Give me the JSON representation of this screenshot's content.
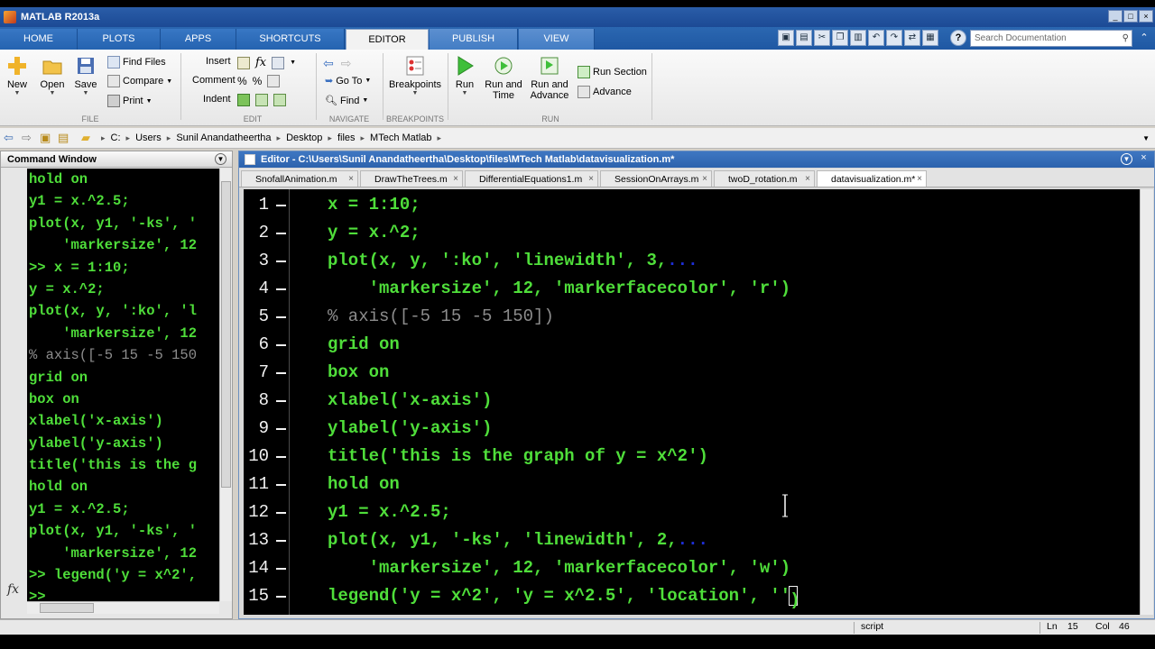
{
  "window": {
    "title": "MATLAB R2013a"
  },
  "tabs": [
    {
      "label": "HOME"
    },
    {
      "label": "PLOTS"
    },
    {
      "label": "APPS"
    },
    {
      "label": "SHORTCUTS"
    },
    {
      "label": "EDITOR"
    },
    {
      "label": "PUBLISH"
    },
    {
      "label": "VIEW"
    }
  ],
  "search": {
    "placeholder": "Search Documentation"
  },
  "ribbon": {
    "new": "New",
    "open": "Open",
    "save": "Save",
    "find_files": "Find Files",
    "compare": "Compare",
    "print": "Print",
    "insert": "Insert",
    "comment": "Comment",
    "indent": "Indent",
    "go_to": "Go To",
    "find": "Find",
    "breakpoints": "Breakpoints",
    "run": "Run",
    "run_and_time_1": "Run and",
    "run_and_time_2": "Time",
    "run_and_advance_1": "Run and",
    "run_and_advance_2": "Advance",
    "run_section": "Run Section",
    "advance": "Advance",
    "groups": {
      "file": "FILE",
      "edit": "EDIT",
      "navigate": "NAVIGATE",
      "breakpoints": "BREAKPOINTS",
      "run": "RUN"
    }
  },
  "path": {
    "crumbs": [
      "C:",
      "Users",
      "Sunil Anandatheertha",
      "Desktop",
      "files",
      "MTech Matlab"
    ]
  },
  "command_window": {
    "title": "Command Window",
    "prompt_symbol": "fx",
    "lines": [
      {
        "text": "hold on",
        "type": "code"
      },
      {
        "text": "y1 = x.^2.5;",
        "type": "code"
      },
      {
        "text": "plot(x, y1, '-ks', '",
        "type": "code"
      },
      {
        "text": "    'markersize', 12",
        "type": "code"
      },
      {
        "text": ">> x = 1:10;",
        "type": "code"
      },
      {
        "text": "y = x.^2;",
        "type": "code"
      },
      {
        "text": "plot(x, y, ':ko', 'l",
        "type": "code"
      },
      {
        "text": "    'markersize', 12",
        "type": "code"
      },
      {
        "text": "% axis([-5 15 -5 150",
        "type": "comment"
      },
      {
        "text": "grid on",
        "type": "code"
      },
      {
        "text": "box on",
        "type": "code"
      },
      {
        "text": "xlabel('x-axis')",
        "type": "code"
      },
      {
        "text": "ylabel('y-axis')",
        "type": "code"
      },
      {
        "text": "title('this is the g",
        "type": "code"
      },
      {
        "text": "hold on",
        "type": "code"
      },
      {
        "text": "y1 = x.^2.5;",
        "type": "code"
      },
      {
        "text": "plot(x, y1, '-ks', '",
        "type": "code"
      },
      {
        "text": "    'markersize', 12",
        "type": "code"
      },
      {
        "text": ">> legend('y = x^2',",
        "type": "code"
      },
      {
        "text": ">> ",
        "type": "code"
      }
    ]
  },
  "editor": {
    "title": "Editor - C:\\Users\\Sunil Anandatheertha\\Desktop\\files\\MTech Matlab\\datavisualization.m*",
    "file_tabs": [
      {
        "label": "SnofallAnimation.m"
      },
      {
        "label": "DrawTheTrees.m"
      },
      {
        "label": "DifferentialEquations1.m"
      },
      {
        "label": "SessionOnArrays.m"
      },
      {
        "label": "twoD_rotation.m"
      },
      {
        "label": "datavisualization.m*"
      }
    ],
    "lines": [
      {
        "n": "1",
        "code": "x = 1:10;"
      },
      {
        "n": "2",
        "code": "y = x.^2;"
      },
      {
        "n": "3",
        "code": "plot(x, y, ':ko', 'linewidth', 3,",
        "ellipsis": "..."
      },
      {
        "n": "4",
        "code": "    'markersize', 12, 'markerfacecolor', 'r')"
      },
      {
        "n": "5",
        "comment": "% axis([-5 15 -5 150])"
      },
      {
        "n": "6",
        "code": "grid on"
      },
      {
        "n": "7",
        "code": "box on"
      },
      {
        "n": "8",
        "code": "xlabel('x-axis')"
      },
      {
        "n": "9",
        "code": "ylabel('y-axis')"
      },
      {
        "n": "10",
        "code": "title('this is the graph of y = x^2')"
      },
      {
        "n": "11",
        "code": "hold on"
      },
      {
        "n": "12",
        "code": "y1 = x.^2.5;"
      },
      {
        "n": "13",
        "code": "plot(x, y1, '-ks', 'linewidth', 2,",
        "ellipsis": "..."
      },
      {
        "n": "14",
        "code": "    'markersize', 12, 'markerfacecolor', 'w')"
      },
      {
        "n": "15",
        "code": "legend('y = x^2', 'y = x^2.5', 'location', ''",
        "caret": ")"
      }
    ]
  },
  "status": {
    "mode": "script",
    "ln_label": "Ln",
    "ln": "15",
    "col_label": "Col",
    "col": "46"
  },
  "colors": {
    "code": "#4fde3a",
    "comment": "#8c8c8c",
    "ellipsis": "#1d2ed8",
    "editor_bg": "#000000",
    "titlebar": "#1c4a95"
  }
}
